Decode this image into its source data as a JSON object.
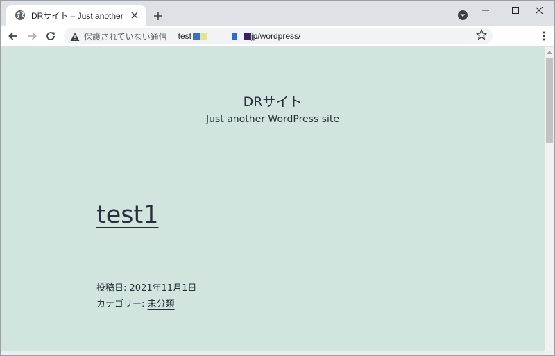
{
  "browser": {
    "tab": {
      "title": "DRサイト – Just another WordPress site",
      "favicon": "globe-icon"
    },
    "window_controls": [
      "minimize-icon",
      "maximize-icon",
      "close-icon"
    ],
    "toolbar": {
      "security_label": "保護されていない通信",
      "url_prefix": "test",
      "url_suffix": "jp/wordpress/"
    }
  },
  "page": {
    "site_title": "DRサイト",
    "site_description": "Just another WordPress site",
    "post": {
      "title": "test1",
      "date_label": "投稿日:",
      "date_value": "2021年11月1日",
      "category_label": "カテゴリー:",
      "category_value": "未分類"
    }
  },
  "colors": {
    "page_background": "#d1e4dd",
    "text": "#28303d",
    "tab_strip": "#dee1e6",
    "omnibox": "#f1f3f4"
  }
}
